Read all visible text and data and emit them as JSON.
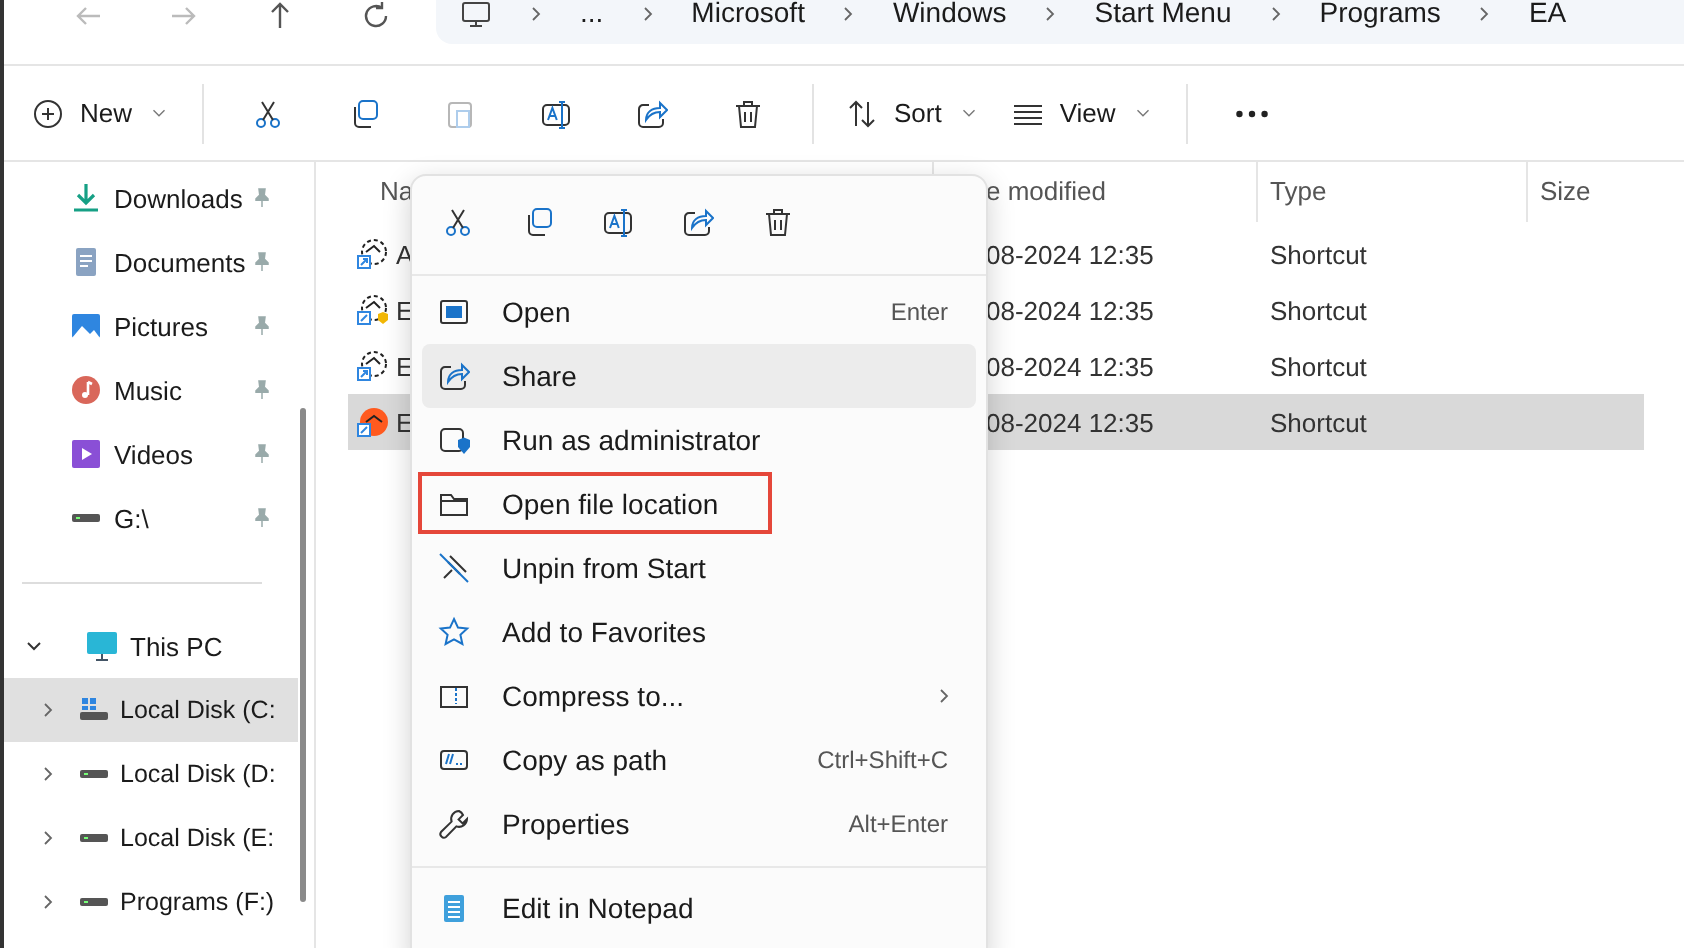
{
  "address": {
    "segments": [
      "...",
      "Microsoft",
      "Windows",
      "Start Menu",
      "Programs",
      "EA"
    ]
  },
  "toolbar": [
    {
      "kind": "new",
      "label": "New",
      "dropdown": true,
      "disabled": false
    },
    {
      "kind": "separator"
    },
    {
      "kind": "cut",
      "disabled": false
    },
    {
      "kind": "copy",
      "disabled": false
    },
    {
      "kind": "paste",
      "disabled": true
    },
    {
      "kind": "rename",
      "disabled": false
    },
    {
      "kind": "share",
      "disabled": false
    },
    {
      "kind": "delete",
      "disabled": false
    },
    {
      "kind": "separator"
    },
    {
      "kind": "sort",
      "label": "Sort",
      "dropdown": true,
      "disabled": false
    },
    {
      "kind": "view",
      "label": "View",
      "dropdown": true,
      "disabled": false
    },
    {
      "kind": "separator"
    },
    {
      "kind": "more",
      "disabled": false
    }
  ],
  "sidebar": {
    "quick_access": [
      {
        "kind": "downloads",
        "label": "Downloads",
        "pinned": true
      },
      {
        "kind": "documents",
        "label": "Documents",
        "pinned": true
      },
      {
        "kind": "pictures",
        "label": "Pictures",
        "pinned": true
      },
      {
        "kind": "music",
        "label": "Music",
        "pinned": true
      },
      {
        "kind": "videos",
        "label": "Videos",
        "pinned": true
      },
      {
        "kind": "drive",
        "label": "G:\\",
        "pinned": true
      }
    ],
    "this_pc": {
      "label": "This PC",
      "expanded": true,
      "children": [
        {
          "kind": "system-drive",
          "label": "Local Disk (C:",
          "selected": true,
          "expanded": false
        },
        {
          "kind": "drive",
          "label": "Local Disk (D:",
          "selected": false,
          "expanded": false
        },
        {
          "kind": "drive",
          "label": "Local Disk (E:",
          "selected": false,
          "expanded": false
        },
        {
          "kind": "drive",
          "label": "Programs (F:)",
          "selected": false,
          "expanded": false
        }
      ]
    }
  },
  "file_list": {
    "columns": [
      "Na",
      "e modified",
      "Type",
      "Size"
    ],
    "rows": [
      {
        "kind": "shortcut",
        "name": "A",
        "date": "08-2024 12:35",
        "type": "Shortcut",
        "selected": false
      },
      {
        "kind": "shortcut-shield",
        "name": "E",
        "date": "08-2024 12:35",
        "type": "Shortcut",
        "selected": false
      },
      {
        "kind": "shortcut",
        "name": "E",
        "date": "08-2024 12:35",
        "type": "Shortcut",
        "selected": false
      },
      {
        "kind": "app",
        "name": "E",
        "date": "08-2024 12:35",
        "type": "Shortcut",
        "selected": true
      }
    ]
  },
  "context_menu": {
    "quick_actions": [
      {
        "kind": "cut"
      },
      {
        "kind": "copy"
      },
      {
        "kind": "rename"
      },
      {
        "kind": "share"
      },
      {
        "kind": "delete"
      }
    ],
    "items": [
      {
        "kind": "open",
        "label": "Open",
        "shortcut": "Enter",
        "hovered": false
      },
      {
        "kind": "share",
        "label": "Share",
        "hovered": true
      },
      {
        "kind": "admin",
        "label": "Run as administrator",
        "hovered": false
      },
      {
        "kind": "folder",
        "label": "Open file location",
        "hovered": false,
        "outlined": true
      },
      {
        "kind": "unpin",
        "label": "Unpin from Start",
        "hovered": false
      },
      {
        "kind": "star",
        "label": "Add to Favorites",
        "hovered": false
      },
      {
        "kind": "zip",
        "label": "Compress to...",
        "hovered": false,
        "submenu": true
      },
      {
        "kind": "path",
        "label": "Copy as path",
        "shortcut": "Ctrl+Shift+C",
        "hovered": false
      },
      {
        "kind": "wrench",
        "label": "Properties",
        "shortcut": "Alt+Enter",
        "hovered": false
      },
      {
        "kind": "separator"
      },
      {
        "kind": "notepad",
        "label": "Edit in Notepad",
        "hovered": false
      }
    ]
  }
}
